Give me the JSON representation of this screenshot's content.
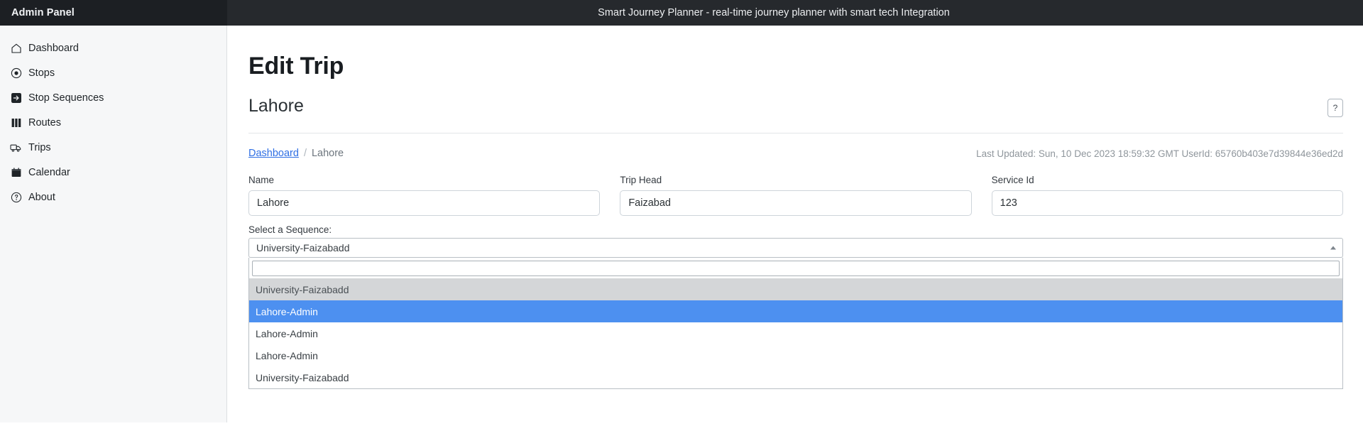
{
  "topbar": {
    "brand": "Admin Panel",
    "app_title": "Smart Journey Planner - real-time journey planner with smart tech Integration"
  },
  "sidebar": {
    "items": [
      {
        "label": "Dashboard",
        "icon": "house-icon"
      },
      {
        "label": "Stops",
        "icon": "circle-dot-icon"
      },
      {
        "label": "Stop Sequences",
        "icon": "arrow-right-square-icon"
      },
      {
        "label": "Routes",
        "icon": "columns-icon"
      },
      {
        "label": "Trips",
        "icon": "truck-icon"
      },
      {
        "label": "Calendar",
        "icon": "calendar-icon"
      },
      {
        "label": "About",
        "icon": "question-circle-icon"
      }
    ]
  },
  "main": {
    "page_title": "Edit Trip",
    "sub_title": "Lahore",
    "help_button_label": "?",
    "breadcrumb": {
      "link": "Dashboard",
      "separator": "/",
      "current": "Lahore"
    },
    "last_updated": "Last Updated: Sun, 10 Dec 2023 18:59:32 GMT UserId: 65760b403e7d39844e36ed2d"
  },
  "form": {
    "fields": [
      {
        "label": "Name",
        "value": "Lahore",
        "placeholder": "Name"
      },
      {
        "label": "Trip Head",
        "value": "Faizabad",
        "placeholder": "Trip Head"
      },
      {
        "label": "Service Id",
        "value": "123",
        "placeholder": "Service Id"
      }
    ]
  },
  "sequence_select": {
    "label": "Select a Sequence:",
    "selected_value": "University-Faizabadd",
    "search_value": "",
    "search_placeholder": "",
    "expanded": true,
    "options": [
      {
        "label": "University-Faizabadd",
        "state": "muted"
      },
      {
        "label": "Lahore-Admin",
        "state": "selected"
      },
      {
        "label": "Lahore-Admin",
        "state": "normal"
      },
      {
        "label": "Lahore-Admin",
        "state": "normal"
      },
      {
        "label": "University-Faizabadd",
        "state": "normal"
      }
    ]
  },
  "colors": {
    "topbar_brand_bg": "#1c1f23",
    "topbar_title_bg": "#26292d",
    "sidebar_bg": "#f6f7f8",
    "link_blue": "#2f6fe4",
    "option_selected_bg": "#4d90f0",
    "option_muted_bg": "#d4d6d8"
  }
}
